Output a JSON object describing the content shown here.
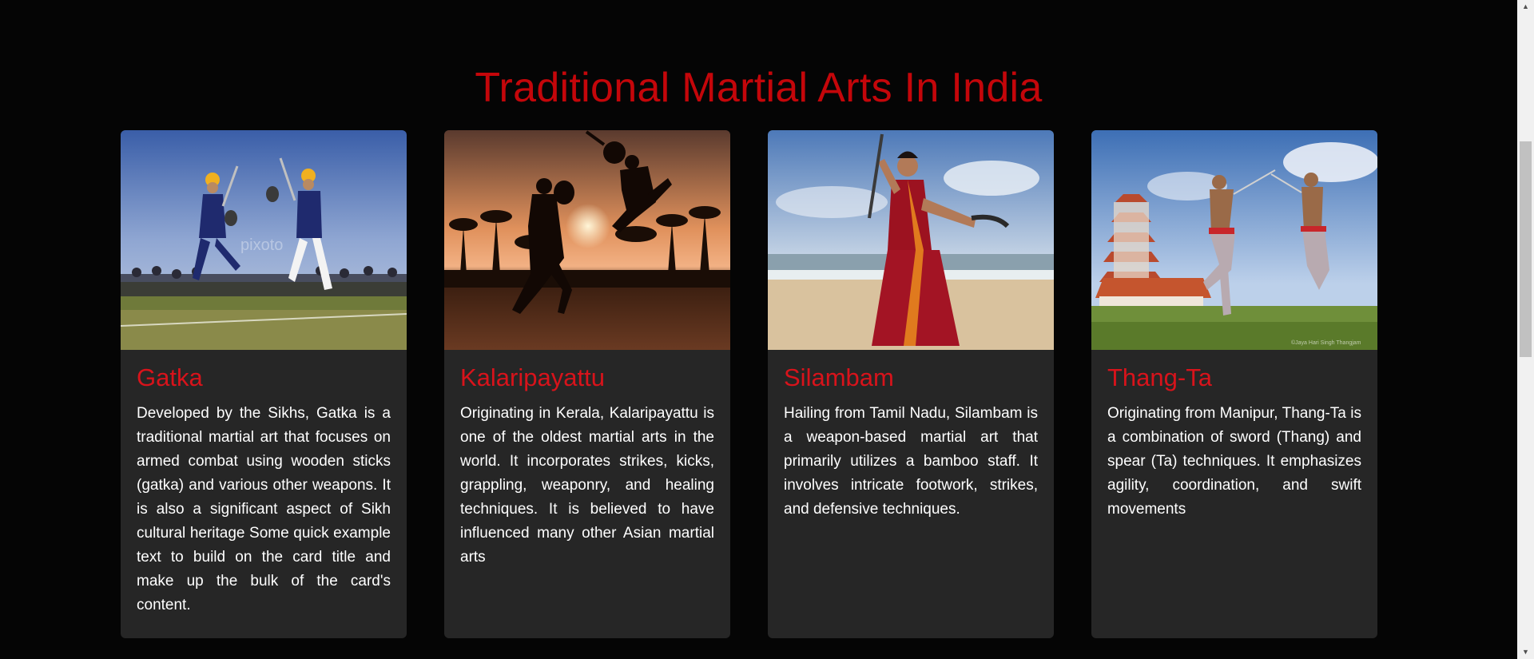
{
  "page": {
    "heading": "Traditional Martial Arts In India"
  },
  "cards": [
    {
      "title": "Gatka",
      "image_alt": "Gatka practitioners with swords and shields",
      "text": "Developed by the Sikhs, Gatka is a traditional martial art that focuses on armed combat using wooden sticks (gatka) and various other weapons. It is also a significant aspect of Sikh cultural heritage Some quick example text to build on the card title and make up the bulk of the card's content."
    },
    {
      "title": "Kalaripayattu",
      "image_alt": "Silhouettes of Kalaripayattu fighters at sunset",
      "text": "Originating in Kerala, Kalaripayattu is one of the oldest martial arts in the world. It incorporates strikes, kicks, grappling, weaponry, and healing techniques. It is believed to have influenced many other Asian martial arts"
    },
    {
      "title": "Silambam",
      "image_alt": "Woman in saree performing Silambam on a beach",
      "text": "Hailing from Tamil Nadu, Silambam is a weapon-based martial art that primarily utilizes a bamboo staff. It involves intricate footwork, strikes, and defensive techniques."
    },
    {
      "title": "Thang-Ta",
      "image_alt": "Two Thang-Ta fighters with swords in a field",
      "text": "Originating from Manipur, Thang-Ta is a combination of sword (Thang) and spear (Ta) techniques. It emphasizes agility, coordination, and swift movements"
    }
  ],
  "colors": {
    "background": "#050505",
    "card_background": "#262626",
    "accent_red": "#c4060a",
    "text_white": "#ffffff"
  },
  "scrollbar": {
    "up_arrow_icon": "▲",
    "down_arrow_icon": "▼"
  }
}
